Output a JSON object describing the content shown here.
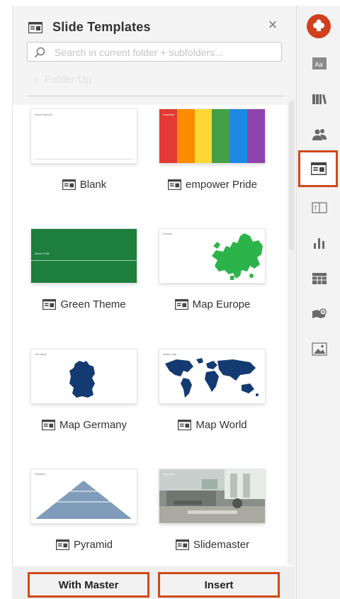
{
  "panel": {
    "title": "Slide Templates",
    "close_symbol": "×",
    "search_placeholder": "Search in current folder + subfolders...",
    "folder_up_label": "Folder Up",
    "folder_up_arrow": "↑"
  },
  "templates": [
    {
      "label": "Blank",
      "thumb_title": "Neuer Abschn"
    },
    {
      "label": "empower Pride",
      "thumb_title": "empower"
    },
    {
      "label": "Green Theme",
      "thumb_title": "Neuer Folie"
    },
    {
      "label": "Map Europe",
      "thumb_title": "Europe"
    },
    {
      "label": "Map Germany",
      "thumb_title": "Germany"
    },
    {
      "label": "Map World",
      "thumb_title": "World map"
    },
    {
      "label": "Pyramid",
      "thumb_title": "Pyramid"
    },
    {
      "label": "Slidemaster",
      "thumb_title": "empower"
    }
  ],
  "footer": {
    "with_master_label": "With Master",
    "insert_label": "Insert"
  },
  "rail_icons": [
    "app-logo-icon",
    "text-styles-icon",
    "library-icon",
    "people-icon",
    "slide-templates-icon",
    "textbox-icon",
    "chart-icon",
    "table-icon",
    "map-icon",
    "image-icon"
  ],
  "colors": {
    "accent": "#d04a18",
    "green_theme": "#1e7e3e",
    "map_green": "#2cb34a",
    "map_navy": "#143a72",
    "pyramid": "#7f9cba",
    "pride": [
      "#e53935",
      "#fb8c00",
      "#fdd835",
      "#43a047",
      "#1e88e5",
      "#8e44ad"
    ]
  }
}
